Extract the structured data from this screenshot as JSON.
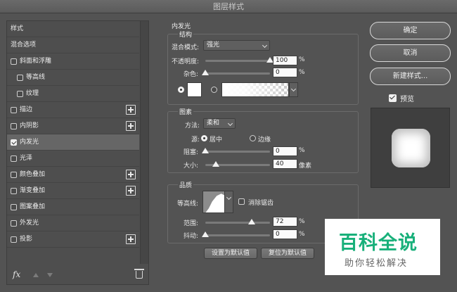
{
  "window": {
    "title": "图层样式"
  },
  "sidebar": {
    "items": [
      {
        "label": "样式",
        "checkbox": false,
        "indent": 0,
        "plus": false,
        "selected": false
      },
      {
        "label": "混合选项",
        "checkbox": false,
        "indent": 0,
        "plus": false,
        "selected": false
      },
      {
        "label": "斜面和浮雕",
        "checkbox": true,
        "checked": false,
        "indent": 0,
        "plus": false,
        "selected": false
      },
      {
        "label": "等高线",
        "checkbox": true,
        "checked": false,
        "indent": 1,
        "plus": false,
        "selected": false
      },
      {
        "label": "纹理",
        "checkbox": true,
        "checked": false,
        "indent": 1,
        "plus": false,
        "selected": false
      },
      {
        "label": "描边",
        "checkbox": true,
        "checked": false,
        "indent": 0,
        "plus": true,
        "selected": false
      },
      {
        "label": "内阴影",
        "checkbox": true,
        "checked": false,
        "indent": 0,
        "plus": true,
        "selected": false
      },
      {
        "label": "内发光",
        "checkbox": true,
        "checked": true,
        "indent": 0,
        "plus": false,
        "selected": true
      },
      {
        "label": "光泽",
        "checkbox": true,
        "checked": false,
        "indent": 0,
        "plus": false,
        "selected": false
      },
      {
        "label": "颜色叠加",
        "checkbox": true,
        "checked": false,
        "indent": 0,
        "plus": true,
        "selected": false
      },
      {
        "label": "渐变叠加",
        "checkbox": true,
        "checked": false,
        "indent": 0,
        "plus": true,
        "selected": false
      },
      {
        "label": "图案叠加",
        "checkbox": true,
        "checked": false,
        "indent": 0,
        "plus": false,
        "selected": false
      },
      {
        "label": "外发光",
        "checkbox": true,
        "checked": false,
        "indent": 0,
        "plus": false,
        "selected": false
      },
      {
        "label": "投影",
        "checkbox": true,
        "checked": false,
        "indent": 0,
        "plus": true,
        "selected": false
      }
    ],
    "footer": {
      "fx_label": "fx"
    }
  },
  "inner_glow": {
    "title": "内发光",
    "structure": {
      "title": "结构",
      "blend_mode_label": "混合模式:",
      "blend_mode_value": "强光",
      "opacity_label": "不透明度:",
      "opacity_value": "100",
      "opacity_unit": "%",
      "opacity_level": 1.0,
      "noise_label": "杂色:",
      "noise_value": "0",
      "noise_unit": "%",
      "noise_level": 0.0
    },
    "elements": {
      "title": "图素",
      "technique_label": "方法:",
      "technique_value": "柔和",
      "source_label": "源:",
      "source_center": "居中",
      "source_edge": "边缘",
      "choke_label": "阻塞:",
      "choke_value": "0",
      "choke_unit": "%",
      "choke_level": 0.0,
      "size_label": "大小:",
      "size_value": "40",
      "size_unit": "像素",
      "size_level": 0.16
    },
    "quality": {
      "title": "品质",
      "contour_label": "等高线:",
      "anti_alias_label": "消除锯齿",
      "range_label": "范围:",
      "range_value": "72",
      "range_unit": "%",
      "range_level": 0.72,
      "jitter_label": "抖动:",
      "jitter_value": "0",
      "jitter_unit": "%",
      "jitter_level": 0.0
    },
    "make_default": "设置为默认值",
    "reset_default": "复位为默认值"
  },
  "actions": {
    "ok": "确定",
    "cancel": "取消",
    "new_style": "新建样式...",
    "preview_label": "预览"
  },
  "watermark": {
    "title": "百科全说",
    "subtitle": "助你轻松解决"
  }
}
